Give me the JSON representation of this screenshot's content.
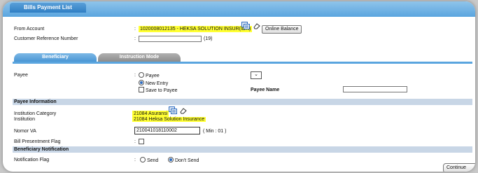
{
  "window": {
    "title": "Bills Payment List"
  },
  "form": {
    "from_account": {
      "label": "From Account",
      "value": "1020008012135 - HEKSA SOLUTION INSUR(IDR)"
    },
    "online_balance_button": "Online Balance",
    "customer_reference": {
      "label": "Customer Reference Number",
      "value": "",
      "max": "(19)"
    }
  },
  "tabs": [
    {
      "label": "Beneficiary",
      "active": true
    },
    {
      "label": "Instruction Mode",
      "active": false
    }
  ],
  "payee": {
    "label": "Payee",
    "option_payee": "Payee",
    "option_new_entry": "New Entry",
    "save_to_payee": "Save to Payee",
    "payee_name_label": "Payee Name",
    "payee_name_value": ""
  },
  "payee_information": {
    "section_title": "Payee Information",
    "institution_category_label": "Institution Category",
    "institution_category_value": "21084 Asuransi",
    "institution_label": "Institution",
    "institution_value": "21084 Heksa Solution Insurance",
    "nomor_va_label": "Nomor VA",
    "nomor_va_value": "210041018110002",
    "nomor_va_hint": "( Min :  01 )",
    "bill_presentment_label": "Bill Presentment Flag"
  },
  "beneficiary_notification": {
    "section_title": "Beneficiary Notification",
    "notification_flag_label": "Notification Flag",
    "option_send": "Send",
    "option_dont_send": "Don't Send"
  },
  "footer": {
    "continue_button": "Continue"
  },
  "colors": {
    "accent": "#5aa5df",
    "highlight": "#ffff33",
    "section": "#c8d6e6"
  }
}
